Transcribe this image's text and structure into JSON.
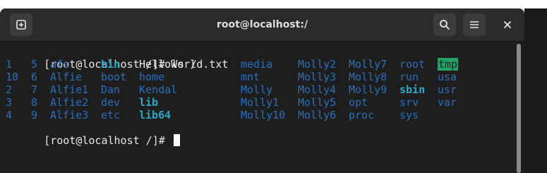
{
  "window": {
    "title": "root@localhost:/"
  },
  "icons": {
    "new_tab": "new-tab-icon",
    "search": "search-icon",
    "menu": "hamburger-menu-icon",
    "close": "close-icon"
  },
  "terminal": {
    "prompt_1": "[root@localhost /]# ls /",
    "prompt_2": "[root@localhost /]# ",
    "listing": [
      [
        {
          "text": "1",
          "kind": "dir"
        },
        {
          "text": "5",
          "kind": "dir"
        },
        {
          "text": "afs",
          "kind": "dir"
        },
        {
          "text": "bin",
          "kind": "exe"
        },
        {
          "text": "HelloWorld.txt",
          "kind": "file"
        },
        {
          "text": "media",
          "kind": "dir"
        },
        {
          "text": "Molly2",
          "kind": "dir"
        },
        {
          "text": "Molly7",
          "kind": "dir"
        },
        {
          "text": "root",
          "kind": "dir"
        },
        {
          "text": "tmp",
          "kind": "highlight"
        }
      ],
      [
        {
          "text": "10",
          "kind": "dir"
        },
        {
          "text": "6",
          "kind": "dir"
        },
        {
          "text": "Alfie",
          "kind": "dir"
        },
        {
          "text": "boot",
          "kind": "dir"
        },
        {
          "text": "home",
          "kind": "dir"
        },
        {
          "text": "mnt",
          "kind": "dir"
        },
        {
          "text": "Molly3",
          "kind": "dir"
        },
        {
          "text": "Molly8",
          "kind": "dir"
        },
        {
          "text": "run",
          "kind": "dir"
        },
        {
          "text": "usa",
          "kind": "dir"
        }
      ],
      [
        {
          "text": "2",
          "kind": "dir"
        },
        {
          "text": "7",
          "kind": "dir"
        },
        {
          "text": "Alfie1",
          "kind": "dir"
        },
        {
          "text": "Dan",
          "kind": "dir"
        },
        {
          "text": "Kendal",
          "kind": "dir"
        },
        {
          "text": "Molly",
          "kind": "dir"
        },
        {
          "text": "Molly4",
          "kind": "dir"
        },
        {
          "text": "Molly9",
          "kind": "dir"
        },
        {
          "text": "sbin",
          "kind": "exe"
        },
        {
          "text": "usr",
          "kind": "dir"
        }
      ],
      [
        {
          "text": "3",
          "kind": "dir"
        },
        {
          "text": "8",
          "kind": "dir"
        },
        {
          "text": "Alfie2",
          "kind": "dir"
        },
        {
          "text": "dev",
          "kind": "dir"
        },
        {
          "text": "lib",
          "kind": "exe"
        },
        {
          "text": "Molly1",
          "kind": "dir"
        },
        {
          "text": "Molly5",
          "kind": "dir"
        },
        {
          "text": "opt",
          "kind": "dir"
        },
        {
          "text": "srv",
          "kind": "dir"
        },
        {
          "text": "var",
          "kind": "dir"
        }
      ],
      [
        {
          "text": "4",
          "kind": "dir"
        },
        {
          "text": "9",
          "kind": "dir"
        },
        {
          "text": "Alfie3",
          "kind": "dir"
        },
        {
          "text": "etc",
          "kind": "dir"
        },
        {
          "text": "lib64",
          "kind": "exe"
        },
        {
          "text": "Molly10",
          "kind": "dir"
        },
        {
          "text": "Molly6",
          "kind": "dir"
        },
        {
          "text": "proc",
          "kind": "dir"
        },
        {
          "text": "sys",
          "kind": "dir"
        },
        {
          "text": "",
          "kind": "dir"
        }
      ]
    ]
  }
}
